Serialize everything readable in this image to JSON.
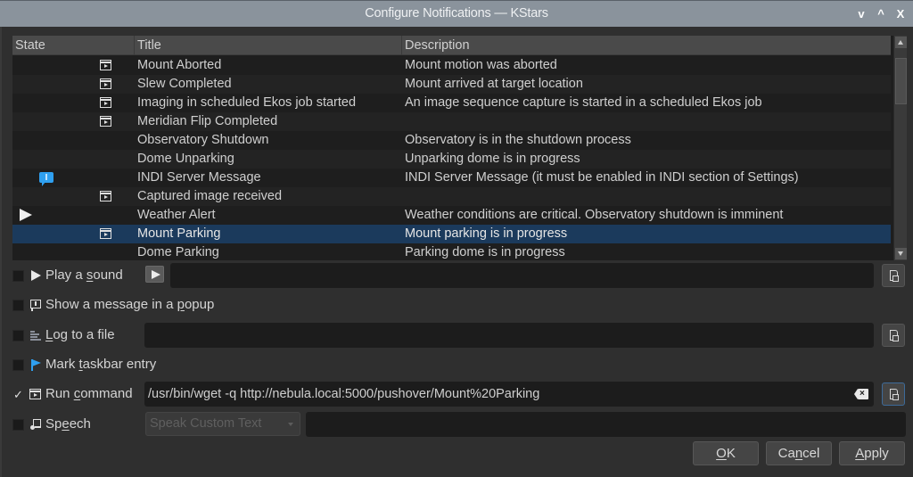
{
  "window": {
    "title": "Configure Notifications — KStars",
    "controls": {
      "minimize": "v",
      "maximize": "^",
      "close": "X"
    }
  },
  "colors": {
    "titlebar": "#8a939c",
    "selection": "#1b3a5c",
    "popup_icon": "#2fa0f0",
    "taskbar_flag": "#2fa0f0"
  },
  "table": {
    "columns": [
      "State",
      "Title",
      "Description"
    ],
    "rows": [
      {
        "state_icons": [
          "execute-icon"
        ],
        "title": "Mount Aborted",
        "description": "Mount motion was aborted",
        "selected": false
      },
      {
        "state_icons": [
          "execute-icon"
        ],
        "title": "Slew Completed",
        "description": "Mount arrived at target location",
        "selected": false
      },
      {
        "state_icons": [
          "execute-icon"
        ],
        "title": "Imaging in scheduled Ekos job started",
        "description": "An image sequence capture is started in a scheduled Ekos job",
        "selected": false
      },
      {
        "state_icons": [
          "execute-icon"
        ],
        "title": "Meridian Flip Completed",
        "description": "",
        "selected": false
      },
      {
        "state_icons": [],
        "title": "Observatory Shutdown",
        "description": "Observatory is in the shutdown process",
        "selected": false
      },
      {
        "state_icons": [],
        "title": "Dome Unparking",
        "description": "Unparking dome is in progress",
        "selected": false
      },
      {
        "state_icons": [
          "popup-icon"
        ],
        "title": "INDI Server Message",
        "description": "INDI Server Message (it must be enabled in INDI section of Settings)",
        "selected": false
      },
      {
        "state_icons": [
          "execute-icon"
        ],
        "title": "Captured image received",
        "description": "",
        "selected": false
      },
      {
        "state_icons": [
          "sound-icon"
        ],
        "title": "Weather Alert",
        "description": "Weather conditions are critical. Observatory shutdown is imminent",
        "selected": false
      },
      {
        "state_icons": [
          "execute-icon"
        ],
        "title": "Mount Parking",
        "description": "Mount parking is in progress",
        "selected": true
      },
      {
        "state_icons": [],
        "title": "Dome Parking",
        "description": "Parking dome is in progress",
        "selected": false
      }
    ]
  },
  "options": {
    "play_sound": {
      "pre": "Play a ",
      "mnemonic": "s",
      "post": "ound",
      "checked": false,
      "value": ""
    },
    "popup": {
      "pre": "Show a message in a ",
      "mnemonic": "p",
      "post": "opup",
      "checked": false
    },
    "log_file": {
      "pre": "",
      "mnemonic": "L",
      "post": "og to a file",
      "checked": false,
      "value": ""
    },
    "taskbar": {
      "pre": "Mark ",
      "mnemonic": "t",
      "post": "askbar entry",
      "checked": false
    },
    "run_command": {
      "pre": "Run ",
      "mnemonic": "c",
      "post": "ommand",
      "checked": true,
      "checkmark": "✓",
      "value": "/usr/bin/wget -q http://nebula.local:5000/pushover/Mount%20Parking"
    },
    "speech": {
      "pre": "Sp",
      "mnemonic": "e",
      "post": "ech",
      "checked": false,
      "combo_value": "Speak Custom Text",
      "value": ""
    }
  },
  "buttons": {
    "ok": {
      "pre": "",
      "mnemonic": "O",
      "post": "K"
    },
    "cancel": {
      "pre": "Ca",
      "mnemonic": "n",
      "post": "cel"
    },
    "apply": {
      "pre": "",
      "mnemonic": "A",
      "post": "pply"
    }
  }
}
